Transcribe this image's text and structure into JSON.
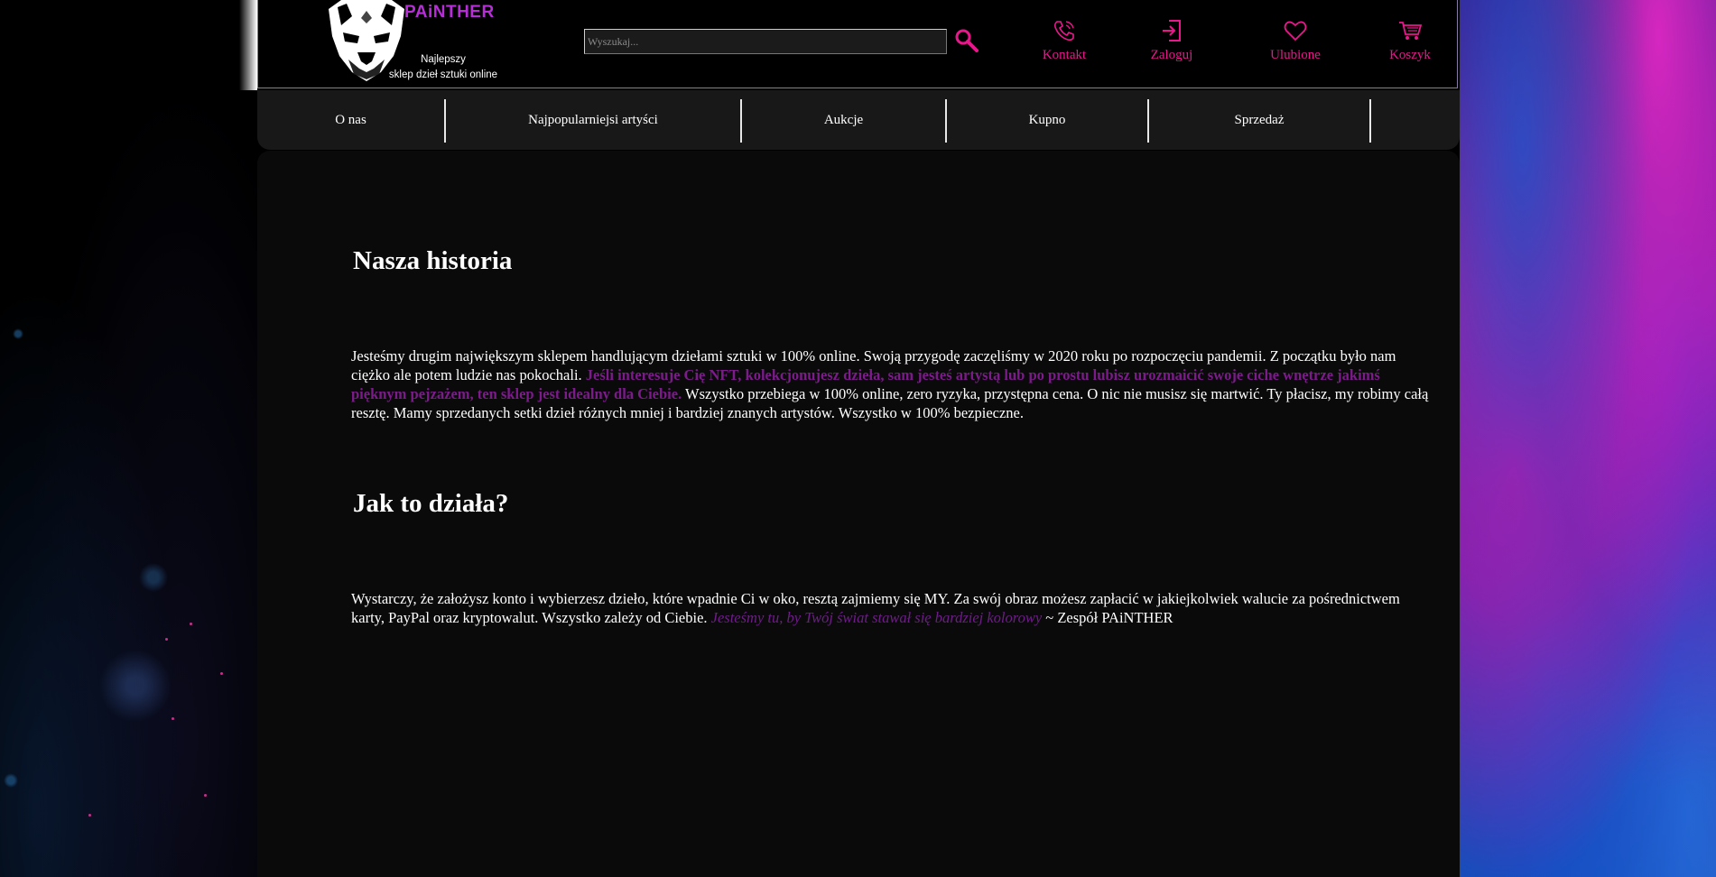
{
  "brand": {
    "name": "PAiNTHER",
    "tagline_line1": "Najlepszy",
    "tagline_line2": "sklep dzieł sztuki online"
  },
  "search": {
    "placeholder": "Wyszukaj..."
  },
  "header_actions": {
    "contact": "Kontakt",
    "login": "Zaloguj",
    "favorites": "Ulubione",
    "cart": "Koszyk"
  },
  "nav": {
    "items": [
      "O nas",
      "Najpopularniejsi artyści",
      "Aukcje",
      "Kupno",
      "Sprzedaż"
    ]
  },
  "content": {
    "history_title": "Nasza historia",
    "history_p1": "Jesteśmy drugim największym sklepem handlującym dziełami sztuki w 100% online. Swoją przygodę zaczęliśmy w 2020 roku po rozpoczęciu pandemii. Z początku było nam ciężko ale potem ludzie nas pokochali. ",
    "history_highlight": "Jeśli interesuje Cię NFT, kolekcjonujesz dzieła, sam jesteś artystą lub po prostu lubisz urozmaicić swoje ciche wnętrze jakimś pięknym pejzażem, ten sklep jest idealny dla Ciebie.",
    "history_p2": " Wszystko przebiega w 100% online, zero ryzyka, przystępna cena. O nic nie musisz się martwić. Ty płacisz, my robimy całą resztę. Mamy sprzedanych setki dzieł różnych mniej i bardziej znanych artystów. Wszystko w 100% bezpieczne.",
    "how_title": "Jak to działa?",
    "how_p1": "Wystarczy, że założysz konto i wybierzesz dzieło, które wpadnie Ci w oko, resztą zajmiemy się MY. Za swój obraz możesz zapłacić w jakiejkolwiek walucie za pośrednictwem karty, PayPal oraz kryptowalut. Wszystko zależy od Ciebie. ",
    "how_quote": "Jesteśmy tu, by Twój świat stawał się bardziej kolorowy",
    "how_signature": " ~ Zespół PAiNTHER"
  },
  "colors": {
    "accent_pink": "#e8188c",
    "accent_purple": "#7d1a8c",
    "brand_purple": "#b52ed6"
  }
}
